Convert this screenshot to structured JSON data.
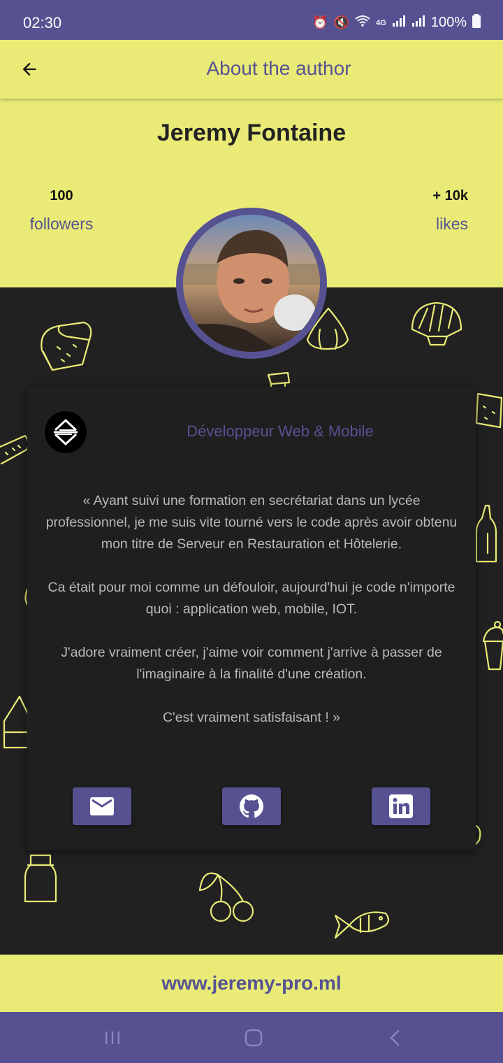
{
  "status_bar": {
    "time": "02:30",
    "battery": "100%",
    "icons": [
      "alarm-icon",
      "mute-icon",
      "wifi-icon",
      "4g-icon",
      "signal-icon",
      "signal-r-icon",
      "battery-icon"
    ]
  },
  "app_bar": {
    "title": "About the author",
    "back_icon": "arrow-back-icon"
  },
  "profile": {
    "name": "Jeremy Fontaine",
    "followers_count": "100",
    "followers_label": "followers",
    "likes_count": "+ 10k",
    "likes_label": "likes"
  },
  "card": {
    "role": "Développeur Web & Mobile",
    "bio": [
      "« Ayant suivi une formation en secrétariat dans un lycée professionnel, je me suis vite tourné vers le code après avoir obtenu mon titre de Serveur en Restauration et Hôtelerie.",
      "Ca était pour moi comme un défouloir, aujourd'hui je code n'importe quoi : application web, mobile, IOT.",
      "J'adore vraiment créer, j'aime voir comment j'arrive à passer de l'imaginaire à la finalité d'une création.",
      "C'est vraiment satisfaisant ! »"
    ],
    "social_buttons": [
      "mail-icon",
      "github-icon",
      "linkedin-icon"
    ]
  },
  "footer": {
    "website": "www.jeremy-pro.ml"
  },
  "nav_bar": {
    "buttons": [
      "recents-icon",
      "home-icon",
      "back-icon"
    ]
  },
  "colors": {
    "primary": "#565292",
    "accent": "#e9eb76",
    "background": "#212121",
    "card": "#1f1f1f",
    "text_muted": "#b9b9b9"
  }
}
